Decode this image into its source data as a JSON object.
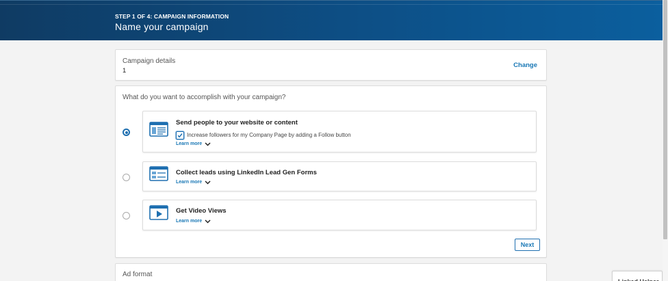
{
  "header": {
    "step_label": "STEP 1 OF 4: CAMPAIGN INFORMATION",
    "title": "Name your campaign"
  },
  "campaign_details": {
    "label": "Campaign details",
    "value": "1",
    "change_label": "Change"
  },
  "objectives": {
    "question": "What do you want to accomplish with your campaign?",
    "options": [
      {
        "title": "Send people to your website or content",
        "selected": true,
        "icon": "webpage-icon",
        "checkbox_label": "Increase followers for my Company Page by adding a Follow button",
        "checkbox_checked": true,
        "learn_more": "Learn more"
      },
      {
        "title": "Collect leads using LinkedIn Lead Gen Forms",
        "selected": false,
        "icon": "lead-form-icon",
        "learn_more": "Learn more"
      },
      {
        "title": "Get Video Views",
        "selected": false,
        "icon": "video-play-icon",
        "learn_more": "Learn more"
      }
    ],
    "next_label": "Next"
  },
  "ad_format": {
    "label": "Ad format"
  },
  "helper": {
    "label": "Linked Helper"
  },
  "colors": {
    "header": "#0d4f86",
    "accent": "#1877b5",
    "background": "#f3f3f3"
  }
}
